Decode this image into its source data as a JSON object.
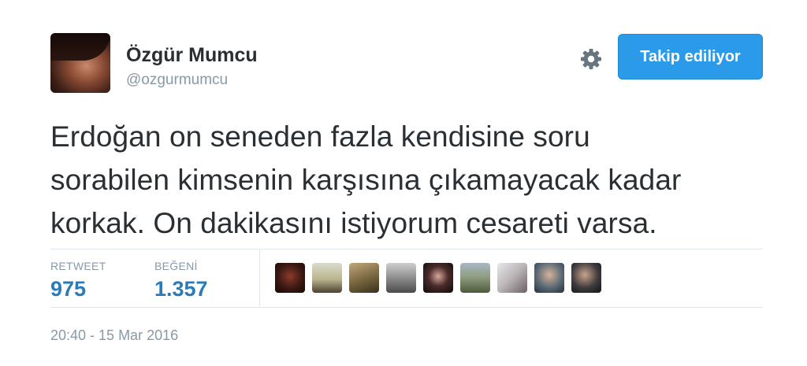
{
  "tweet": {
    "author": {
      "display_name": "Özgür Mumcu",
      "handle": "@ozgurmumcu"
    },
    "follow_button_label": "Takip ediliyor",
    "text_lines": [
      "Erdoğan on seneden fazla kendisine soru",
      "sorabilen kimsenin karşısına çıkamayacak kadar",
      "korkak. On dakikasını istiyorum cesareti varsa."
    ],
    "stats": {
      "retweets_label": "RETWEET",
      "retweets_count": "975",
      "likes_label": "BEĞENİ",
      "likes_count": "1.357"
    },
    "timestamp": "20:40 - 15 Mar 2016"
  },
  "icons": {
    "settings": "gear-icon"
  },
  "colors": {
    "follow_button_bg": "#2b9ae8",
    "stat_count": "#2b7bb9",
    "muted_text": "#8899a6",
    "divider": "#e1e8ed"
  }
}
